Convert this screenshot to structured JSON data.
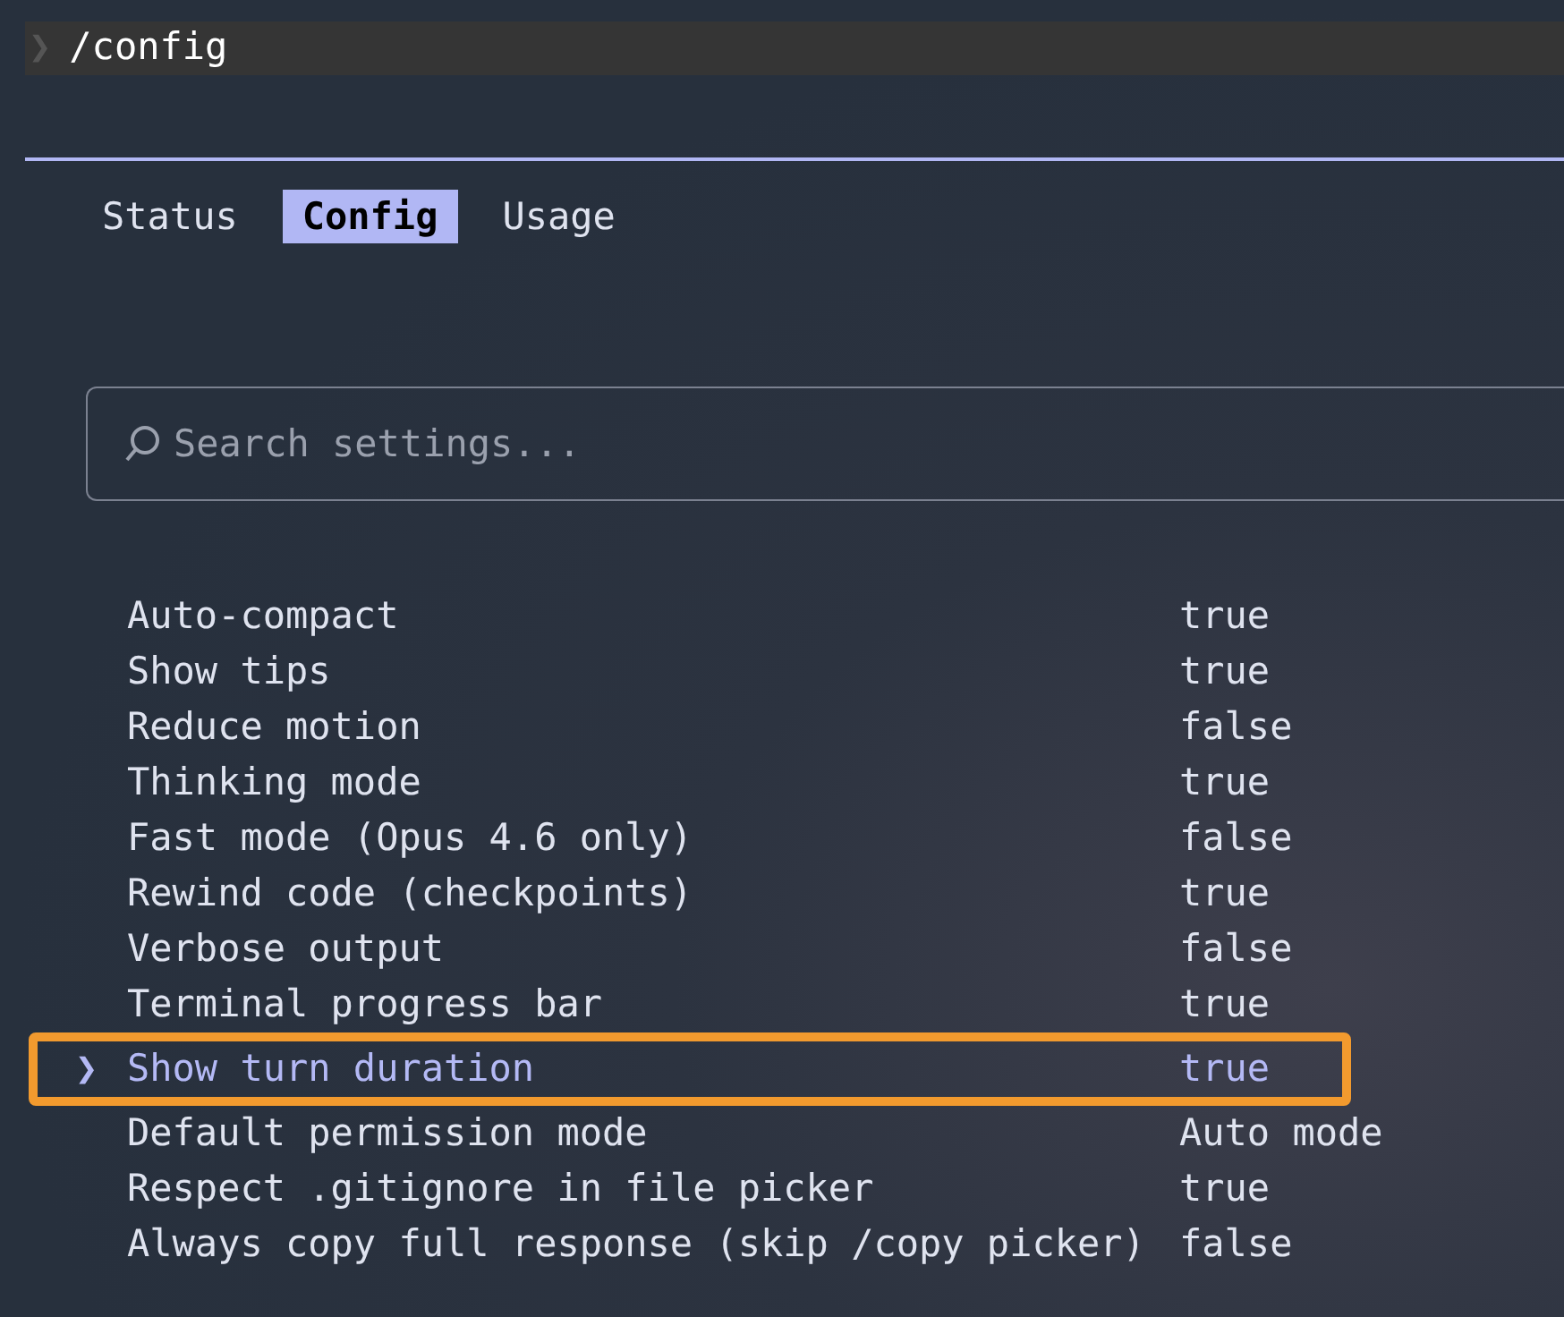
{
  "command": {
    "prompt": "❯",
    "text": "/config"
  },
  "tabs": [
    {
      "label": "Status",
      "selected": false
    },
    {
      "label": "Config",
      "selected": true
    },
    {
      "label": "Usage",
      "selected": false
    }
  ],
  "search": {
    "placeholder": "Search settings..."
  },
  "pointer": "❯",
  "settings": [
    {
      "label": "Auto-compact",
      "value": "true",
      "selected": false,
      "highlighted": false
    },
    {
      "label": "Show tips",
      "value": "true",
      "selected": false,
      "highlighted": false
    },
    {
      "label": "Reduce motion",
      "value": "false",
      "selected": false,
      "highlighted": false
    },
    {
      "label": "Thinking mode",
      "value": "true",
      "selected": false,
      "highlighted": false
    },
    {
      "label": "Fast mode (Opus 4.6 only)",
      "value": "false",
      "selected": false,
      "highlighted": false
    },
    {
      "label": "Rewind code (checkpoints)",
      "value": "true",
      "selected": false,
      "highlighted": false
    },
    {
      "label": "Verbose output",
      "value": "false",
      "selected": false,
      "highlighted": false
    },
    {
      "label": "Terminal progress bar",
      "value": "true",
      "selected": false,
      "highlighted": false
    },
    {
      "label": "Show turn duration",
      "value": "true",
      "selected": true,
      "highlighted": true
    },
    {
      "label": "Default permission mode",
      "value": "Auto mode",
      "selected": false,
      "highlighted": false
    },
    {
      "label": "Respect .gitignore in file picker",
      "value": "true",
      "selected": false,
      "highlighted": false
    },
    {
      "label": "Always copy full response (skip /copy picker)",
      "value": "false",
      "selected": false,
      "highlighted": false
    }
  ]
}
